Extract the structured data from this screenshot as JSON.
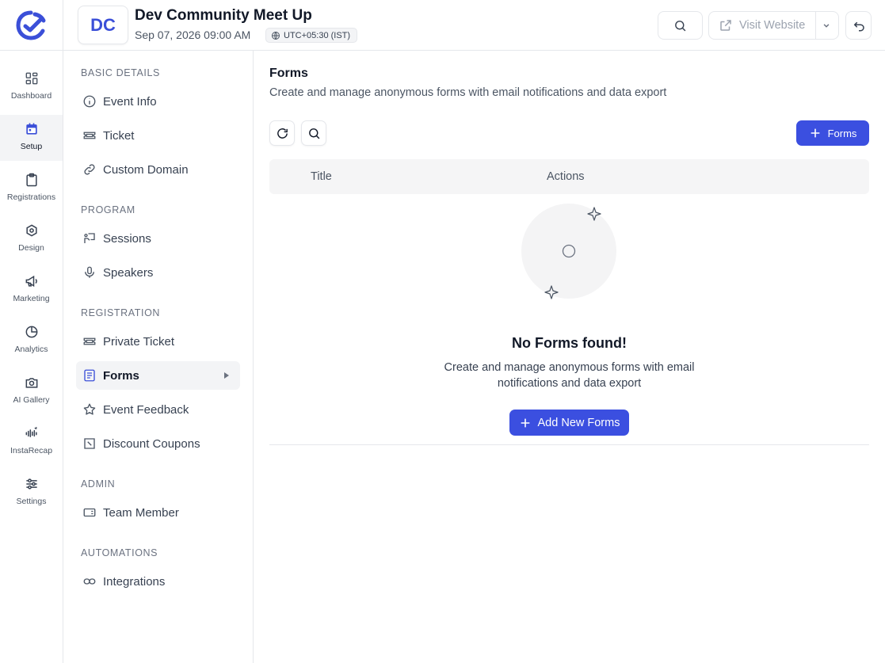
{
  "header": {
    "event_initials": "DC",
    "event_title": "Dev Community Meet Up",
    "event_datetime": "Sep 07, 2026 09:00 AM",
    "timezone": "UTC+05:30 (IST)",
    "visit_website_label": "Visit Website"
  },
  "rail": {
    "items": [
      {
        "label": "Dashboard",
        "icon": "dashboard-icon"
      },
      {
        "label": "Setup",
        "icon": "calendar-icon",
        "active": true
      },
      {
        "label": "Registrations",
        "icon": "clipboard-icon"
      },
      {
        "label": "Design",
        "icon": "design-icon"
      },
      {
        "label": "Marketing",
        "icon": "megaphone-icon"
      },
      {
        "label": "Analytics",
        "icon": "pie-chart-icon"
      },
      {
        "label": "AI Gallery",
        "icon": "camera-icon"
      },
      {
        "label": "InstaRecap",
        "icon": "audio-wave-icon"
      },
      {
        "label": "Settings",
        "icon": "sliders-icon"
      }
    ]
  },
  "subnav": {
    "sections": [
      {
        "title": "BASIC DETAILS",
        "items": [
          "Event Info",
          "Ticket",
          "Custom Domain"
        ]
      },
      {
        "title": "PROGRAM",
        "items": [
          "Sessions",
          "Speakers"
        ]
      },
      {
        "title": "REGISTRATION",
        "items": [
          "Private Ticket",
          "Forms",
          "Event Feedback",
          "Discount Coupons"
        ]
      },
      {
        "title": "ADMIN",
        "items": [
          "Team Member"
        ]
      },
      {
        "title": "AUTOMATIONS",
        "items": [
          "Integrations"
        ]
      }
    ],
    "active_item": "Forms"
  },
  "main": {
    "title": "Forms",
    "subtitle": "Create and manage anonymous forms with email notifications and data export",
    "add_button_label": "Forms",
    "table": {
      "columns": [
        "Title",
        "Actions"
      ],
      "rows": []
    },
    "empty_state": {
      "title": "No Forms found!",
      "description": "Create and manage anonymous forms with email notifications and data export",
      "button_label": "Add New Forms"
    }
  },
  "colors": {
    "accent": "#3b4fe0",
    "brand": "#3b4fd8",
    "border": "#e5e7eb",
    "active_bg": "#f3f4f6"
  }
}
